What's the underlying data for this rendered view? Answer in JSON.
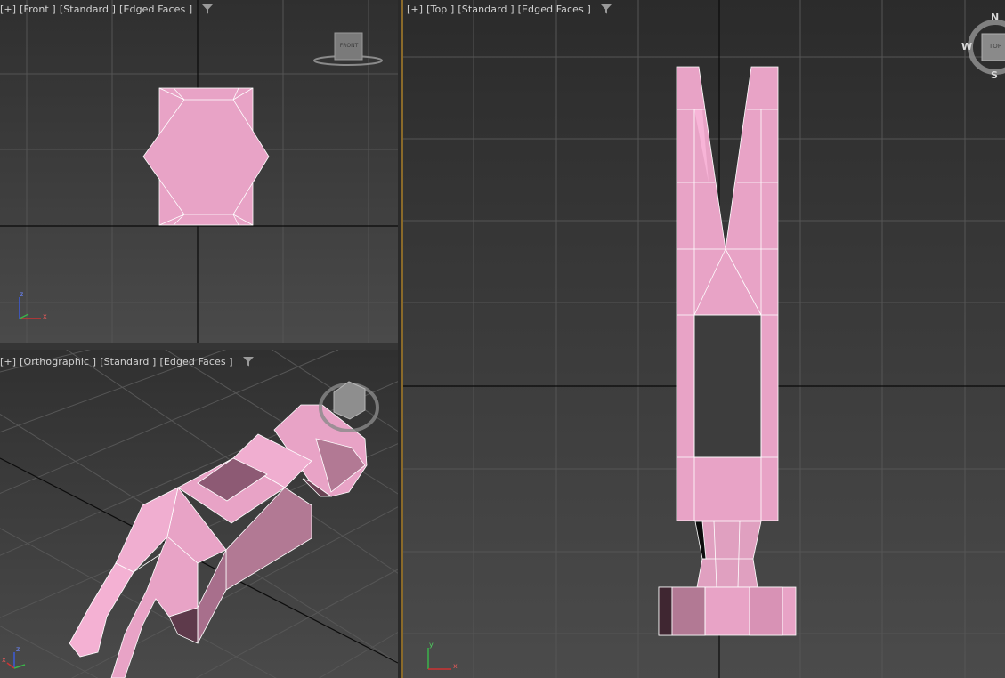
{
  "viewports": {
    "front": {
      "plus": "[+]",
      "view": "[Front ]",
      "shading": "[Standard ]",
      "edges": "[Edged Faces ]",
      "cube_label": "FRONT"
    },
    "ortho": {
      "plus": "[+]",
      "view": "[Orthographic ]",
      "shading": "[Standard ]",
      "edges": "[Edged Faces ]"
    },
    "top": {
      "plus": "[+]",
      "view": "[Top ]",
      "shading": "[Standard ]",
      "edges": "[Edged Faces ]",
      "cube_label": "TOP",
      "compass": {
        "n": "N",
        "w": "W",
        "s": "S"
      }
    }
  },
  "axes": {
    "x": "x",
    "y": "y",
    "z": "z"
  },
  "colors": {
    "mesh": "#e8a3c6",
    "mesh_light": "#f7b4d7",
    "mesh_dark": "#a86f8c",
    "active_border": "#8a6a2a"
  },
  "icons": {
    "filter": "filter-icon",
    "viewcube": "viewcube-icon",
    "axis_tripod": "axis-tripod-icon"
  }
}
